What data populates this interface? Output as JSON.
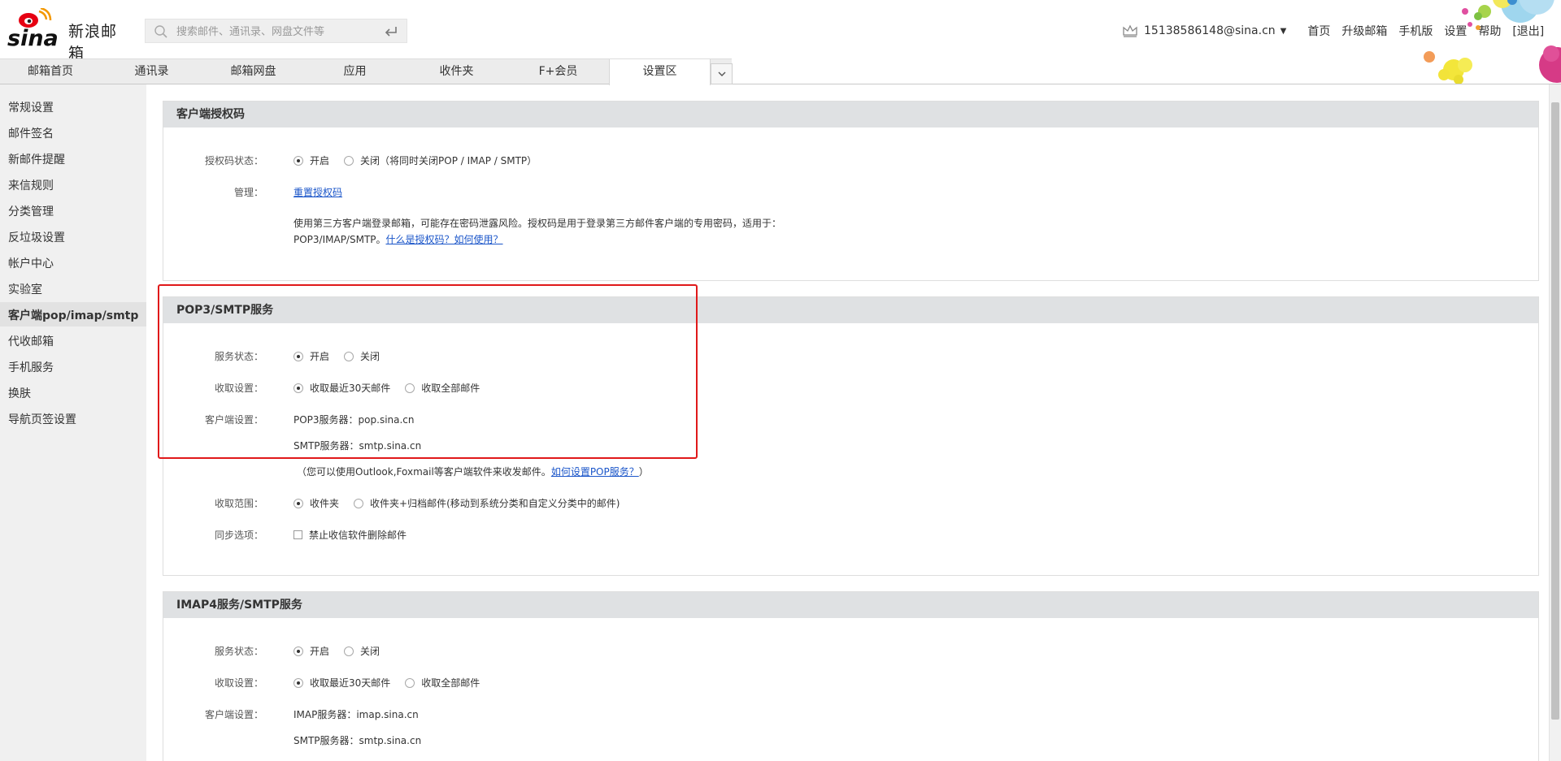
{
  "header": {
    "brand_text": "新浪邮箱",
    "search_placeholder": "搜索邮件、通讯录、网盘文件等",
    "user_email": "15138586148@sina.cn",
    "nav_links": [
      "首页",
      "升级邮箱",
      "手机版",
      "设置",
      "帮助",
      "[退出]"
    ]
  },
  "tabs": [
    "邮箱首页",
    "通讯录",
    "邮箱网盘",
    "应用",
    "收件夹",
    "F+会员",
    "设置区"
  ],
  "active_tab_index": 6,
  "sidebar": {
    "items": [
      "常规设置",
      "邮件签名",
      "新邮件提醒",
      "来信规则",
      "分类管理",
      "反垃圾设置",
      "帐户中心",
      "实验室",
      "客户端pop/imap/smtp",
      "代收邮箱",
      "手机服务",
      "换肤",
      "导航页签设置"
    ],
    "active_index": 8
  },
  "auth_section": {
    "title": "客户端授权码",
    "status_label": "授权码状态：",
    "status_on": "开启",
    "status_off": "关闭（将同时关闭POP / IMAP / SMTP）",
    "manage_label": "管理：",
    "reset_link": "重置授权码",
    "note_line1": "使用第三方客户端登录邮箱，可能存在密码泄露风险。授权码是用于登录第三方邮件客户端的专用密码，适用于：",
    "note_line2_prefix": "POP3/IMAP/SMTP。",
    "note_link": "什么是授权码？如何使用？"
  },
  "pop_section": {
    "title": "POP3/SMTP服务",
    "service_label": "服务状态：",
    "on": "开启",
    "off": "关闭",
    "fetch_label": "收取设置：",
    "fetch_recent": "收取最近30天邮件",
    "fetch_all": "收取全部邮件",
    "client_label": "客户端设置：",
    "pop3_server": "POP3服务器：pop.sina.cn",
    "smtp_server": "SMTP服务器：smtp.sina.cn",
    "hint_prefix": "（您可以使用Outlook,Foxmail等客户端软件来收发邮件。",
    "hint_link": "如何设置POP服务？",
    "hint_suffix": "）",
    "range_label": "收取范围：",
    "range_inbox": "收件夹",
    "range_archive": "收件夹+归档邮件(移动到系统分类和自定义分类中的邮件)",
    "sync_label": "同步选项：",
    "sync_option": "禁止收信软件删除邮件"
  },
  "imap_section": {
    "title": "IMAP4服务/SMTP服务",
    "service_label": "服务状态：",
    "on": "开启",
    "off": "关闭",
    "fetch_label": "收取设置：",
    "fetch_recent": "收取最近30天邮件",
    "fetch_all": "收取全部邮件",
    "client_label": "客户端设置：",
    "imap_server": "IMAP服务器：imap.sina.cn",
    "smtp_server": "SMTP服务器：smtp.sina.cn"
  },
  "colors": {
    "brand_red": "#e60012",
    "link": "#1a55c9",
    "highlight": "#e0191a",
    "section_header_bg": "#dfe1e3"
  }
}
